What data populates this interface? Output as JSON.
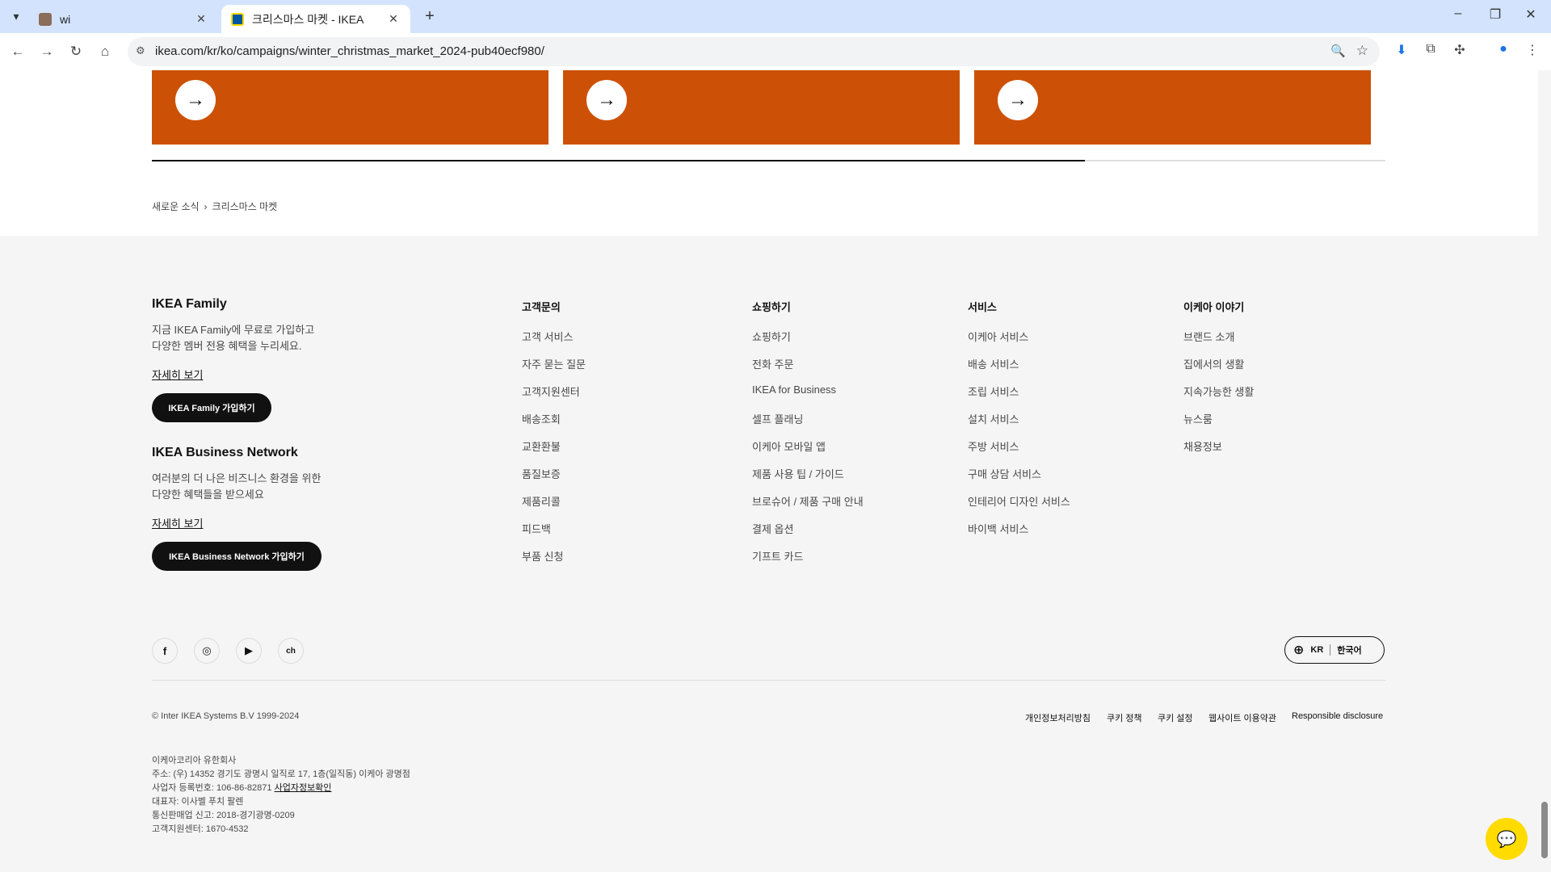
{
  "browser": {
    "tabs": [
      {
        "title": "wi",
        "active": false
      },
      {
        "title": "크리스마스 마켓 - IKEA",
        "active": true
      }
    ],
    "url": "ikea.com/kr/ko/campaigns/winter_christmas_market_2024-pub40ecf980/"
  },
  "icons": {
    "tab_list": "▾",
    "close": "✕",
    "new_tab": "+",
    "minimize": "–",
    "restore": "❐",
    "window_close": "✕",
    "back": "←",
    "forward": "→",
    "reload": "↻",
    "home": "⌂",
    "site_info": "⚙",
    "zoom": "🔍",
    "star": "☆",
    "download": "⬇",
    "extensions": "⧉",
    "puzzle": "✣",
    "profile": "●",
    "menu": "⋮",
    "arrow_right": "→",
    "globe": "⊕",
    "chat": "💬"
  },
  "colors": {
    "card": "#cc5106",
    "chat": "#ffdb00"
  },
  "breadcrumb": {
    "parent": "새로운 소식",
    "current": "크리스마스 마켓"
  },
  "footer": {
    "family": {
      "title": "IKEA Family",
      "text_line1": "지금 IKEA Family에 무료로 가입하고",
      "text_line2": "다양한 멤버 전용 혜택을 누리세요.",
      "more": "자세히 보기",
      "button": "IKEA Family 가입하기"
    },
    "business": {
      "title": "IKEA Business Network",
      "text_line1": "여러분의 더 나은 비즈니스 환경을 위한",
      "text_line2": "다양한 혜택들을 받으세요",
      "more": "자세히 보기",
      "button": "IKEA Business Network 가입하기"
    },
    "columns": [
      {
        "heading": "고객문의",
        "items": [
          "고객 서비스",
          "자주 묻는 질문",
          "고객지원센터",
          "배송조회",
          "교환환불",
          "품질보증",
          "제품리콜",
          "피드백",
          "부품 신청"
        ]
      },
      {
        "heading": "쇼핑하기",
        "items": [
          "쇼핑하기",
          "전화 주문",
          "IKEA for Business",
          "셀프 플래닝",
          "이케아 모바일 앱",
          "제품 사용 팁 / 가이드",
          "브로슈어 / 제품 구매 안내",
          "결제 옵션",
          "기프트 카드"
        ]
      },
      {
        "heading": "서비스",
        "items": [
          "이케아 서비스",
          "배송 서비스",
          "조립 서비스",
          "설치 서비스",
          "주방 서비스",
          "구매 상담 서비스",
          "인테리어 디자인 서비스",
          "바이백 서비스"
        ]
      },
      {
        "heading": "이케아 이야기",
        "items": [
          "브랜드 소개",
          "집에서의 생활",
          "지속가능한 생활",
          "뉴스룸",
          "채용정보"
        ]
      }
    ],
    "social": [
      "f",
      "◎",
      "▶",
      "ch"
    ],
    "language": {
      "country": "KR",
      "lang": "한국어"
    },
    "copyright": "© Inter IKEA Systems B.V 1999-2024",
    "legal_links": [
      "개인정보처리방침",
      "쿠키 정책",
      "쿠키 설정",
      "웹사이트 이용약관",
      "Responsible disclosure"
    ],
    "company": {
      "name": "이케아코리아 유한회사",
      "address": "주소: (우) 14352 경기도 광명시 일직로 17, 1층(일직동) 이케아 광명점",
      "biz_no_label": "사업자 등록번호: 106-86-82871",
      "biz_info_link": "사업자정보확인",
      "ceo": "대표자: 이사벨 푸치 팔렌",
      "ecommerce": "통신판매업 신고: 2018-경기광명-0209",
      "support": "고객지원센터: 1670-4532"
    }
  }
}
